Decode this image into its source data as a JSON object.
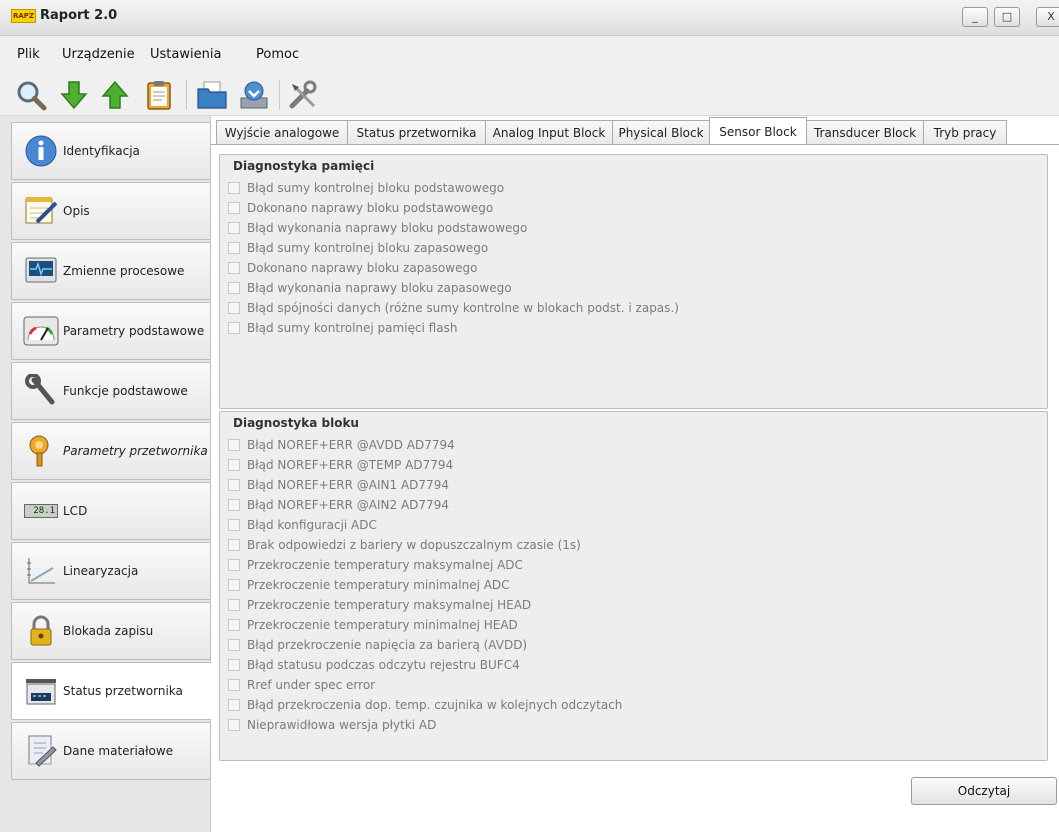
{
  "window": {
    "logo_text": "RAPZ",
    "title": "Raport 2.0",
    "controls": {
      "minimize": "_",
      "maximize": "□",
      "close": "X"
    }
  },
  "menu": {
    "items": [
      "Plik",
      "Urządzenie",
      "Ustawienia",
      "Pomoc"
    ]
  },
  "toolbar": {
    "icons": [
      "search-icon",
      "download-arrow-icon",
      "upload-arrow-icon",
      "clipboard-icon",
      "open-folder-icon",
      "save-drive-icon",
      "tools-icon"
    ]
  },
  "sidebar": {
    "items": [
      {
        "label": "Identyfikacja",
        "icon": "info-icon",
        "italic": false
      },
      {
        "label": "Opis",
        "icon": "notepad-icon",
        "italic": false
      },
      {
        "label": "Zmienne procesowe",
        "icon": "monitor-pulse-icon",
        "italic": false
      },
      {
        "label": "Parametry podstawowe",
        "icon": "gauge-icon",
        "italic": false
      },
      {
        "label": "Funkcje podstawowe",
        "icon": "wrench-icon",
        "italic": false
      },
      {
        "label": "Parametry przetwornika",
        "icon": "transmitter-icon",
        "italic": true
      },
      {
        "label": "LCD",
        "icon": "lcd-icon",
        "lcd_text": "28.1",
        "italic": false
      },
      {
        "label": "Linearyzacja",
        "icon": "graph-icon",
        "italic": false
      },
      {
        "label": "Blokada zapisu",
        "icon": "padlock-icon",
        "italic": false
      },
      {
        "label": "Status przetwornika",
        "icon": "status-device-icon",
        "italic": false,
        "active": true
      },
      {
        "label": "Dane materiałowe",
        "icon": "document-icon",
        "italic": false
      }
    ]
  },
  "tabs": [
    {
      "label": "Wyjście analogowe"
    },
    {
      "label": "Status przetwornika"
    },
    {
      "label": "Analog Input Block"
    },
    {
      "label": "Physical Block"
    },
    {
      "label": "Sensor Block",
      "active": true
    },
    {
      "label": "Transducer Block"
    },
    {
      "label": "Tryb pracy"
    }
  ],
  "memory_diagnostics": {
    "title": "Diagnostyka pamięci",
    "items": [
      "Błąd sumy kontrolnej bloku podstawowego",
      "Dokonano naprawy bloku podstawowego",
      "Błąd wykonania naprawy bloku podstawowego",
      "Błąd sumy kontrolnej bloku zapasowego",
      "Dokonano naprawy bloku zapasowego",
      "Błąd wykonania naprawy bloku zapasowego",
      "Błąd spójności danych (różne sumy kontrolne w blokach podst. i zapas.)",
      "Błąd sumy kontrolnej pamięci flash"
    ]
  },
  "block_diagnostics": {
    "title": "Diagnostyka bloku",
    "items": [
      "Błąd NOREF+ERR @AVDD AD7794",
      "Błąd NOREF+ERR @TEMP AD7794",
      "Błąd NOREF+ERR @AIN1 AD7794",
      "Błąd NOREF+ERR @AIN2 AD7794",
      "Błąd konfiguracji ADC",
      "Brak odpowiedzi z bariery w dopuszczalnym czasie (1s)",
      "Przekroczenie temperatury maksymalnej ADC",
      "Przekroczenie temperatury minimalnej ADC",
      "Przekroczenie temperatury maksymalnej HEAD",
      "Przekroczenie temperatury minimalnej HEAD",
      "Błąd przekroczenie napięcia za barierą (AVDD)",
      "Błąd statusu podczas odczytu rejestru BUFC4",
      "Rref under spec error",
      "Błąd przekroczenia dop. temp. czujnika w kolejnych odczytach",
      "Nieprawidłowa wersja płytki AD"
    ]
  },
  "actions": {
    "read_label": "Odczytaj"
  }
}
